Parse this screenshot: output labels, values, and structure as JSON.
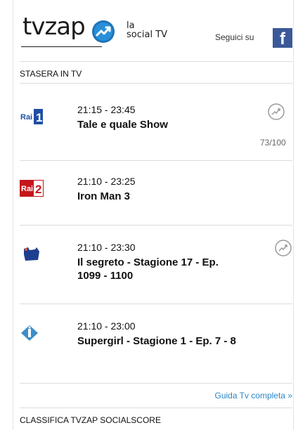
{
  "header": {
    "logo": "tvzap",
    "tagline_line1": "la",
    "tagline_line2": "social TV",
    "follow_label": "Seguici su",
    "facebook_letter": "f"
  },
  "tonight": {
    "section_title": "STASERA IN TV",
    "programs": [
      {
        "channel": "Rai 1",
        "time": "21:15 - 23:45",
        "title": "Tale e quale Show",
        "score": "73/100"
      },
      {
        "channel": "Rai 2",
        "time": "21:10 - 23:25",
        "title": "Iron Man 3"
      },
      {
        "channel": "Canale 5",
        "time": "21:10 - 23:30",
        "title": "Il segreto - Stagione 17 - Ep. 1099 - 1100"
      },
      {
        "channel": "Italia 1",
        "time": "21:10 - 23:00",
        "title": "Supergirl - Stagione 1 - Ep. 7 - 8"
      }
    ],
    "full_guide_link": "Guida Tv completa »"
  },
  "ranking": {
    "section_title": "CLASSIFICA TVZAP SOCIALSCORE"
  },
  "colors": {
    "rai_red": "#c4161c",
    "rai_blue": "#1f4fa3",
    "link_blue": "#2b86c5",
    "facebook_blue": "#3b5998"
  }
}
